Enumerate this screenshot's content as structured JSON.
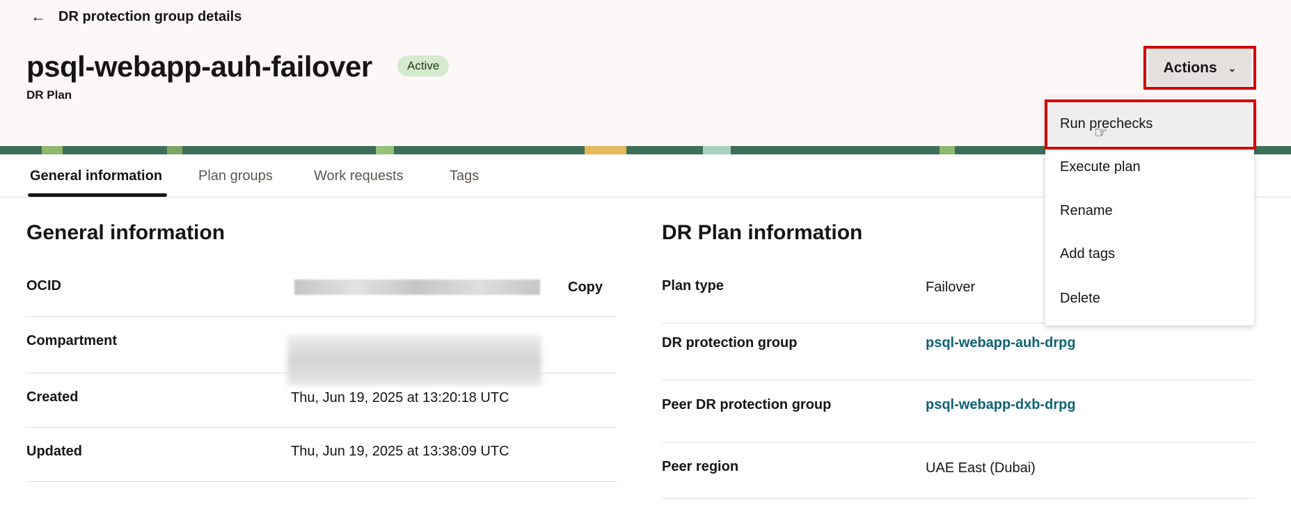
{
  "header": {
    "back_label": "DR protection group details",
    "title": "psql-webapp-auh-failover",
    "status": "Active",
    "subtitle": "DR Plan",
    "actions_label": "Actions"
  },
  "icons": {
    "back": "arrow-left-icon",
    "actions_chevron": "chevron-down-icon",
    "cursor": "hand-pointer-icon"
  },
  "actions_menu": {
    "items": [
      {
        "label": "Run prechecks"
      },
      {
        "label": "Execute plan"
      },
      {
        "label": "Rename"
      },
      {
        "label": "Add tags"
      },
      {
        "label": "Delete"
      }
    ]
  },
  "tabs": [
    {
      "label": "General information",
      "active": true
    },
    {
      "label": "Plan groups"
    },
    {
      "label": "Work requests"
    },
    {
      "label": "Tags"
    }
  ],
  "general": {
    "title": "General information",
    "copy_label": "Copy",
    "rows": [
      {
        "label": "OCID",
        "value": ""
      },
      {
        "label": "Compartment",
        "value": ""
      },
      {
        "label": "Created",
        "value": "Thu, Jun 19, 2025 at 13:20:18 UTC"
      },
      {
        "label": "Updated",
        "value": "Thu, Jun 19, 2025 at 13:38:09 UTC"
      }
    ]
  },
  "plan_info": {
    "title": "DR Plan information",
    "rows": [
      {
        "label": "Plan type",
        "value": "Failover"
      },
      {
        "label": "DR protection group",
        "value": "psql-webapp-auh-drpg"
      },
      {
        "label": "Peer DR protection group",
        "value": "psql-webapp-dxb-drpg"
      },
      {
        "label": "Peer region",
        "value": "UAE East (Dubai)"
      }
    ]
  },
  "colors": {
    "status_badge": "#d4ebcd",
    "link": "#0d6275",
    "highlight_outline": "#d40000",
    "banner": "#3d6e58"
  }
}
